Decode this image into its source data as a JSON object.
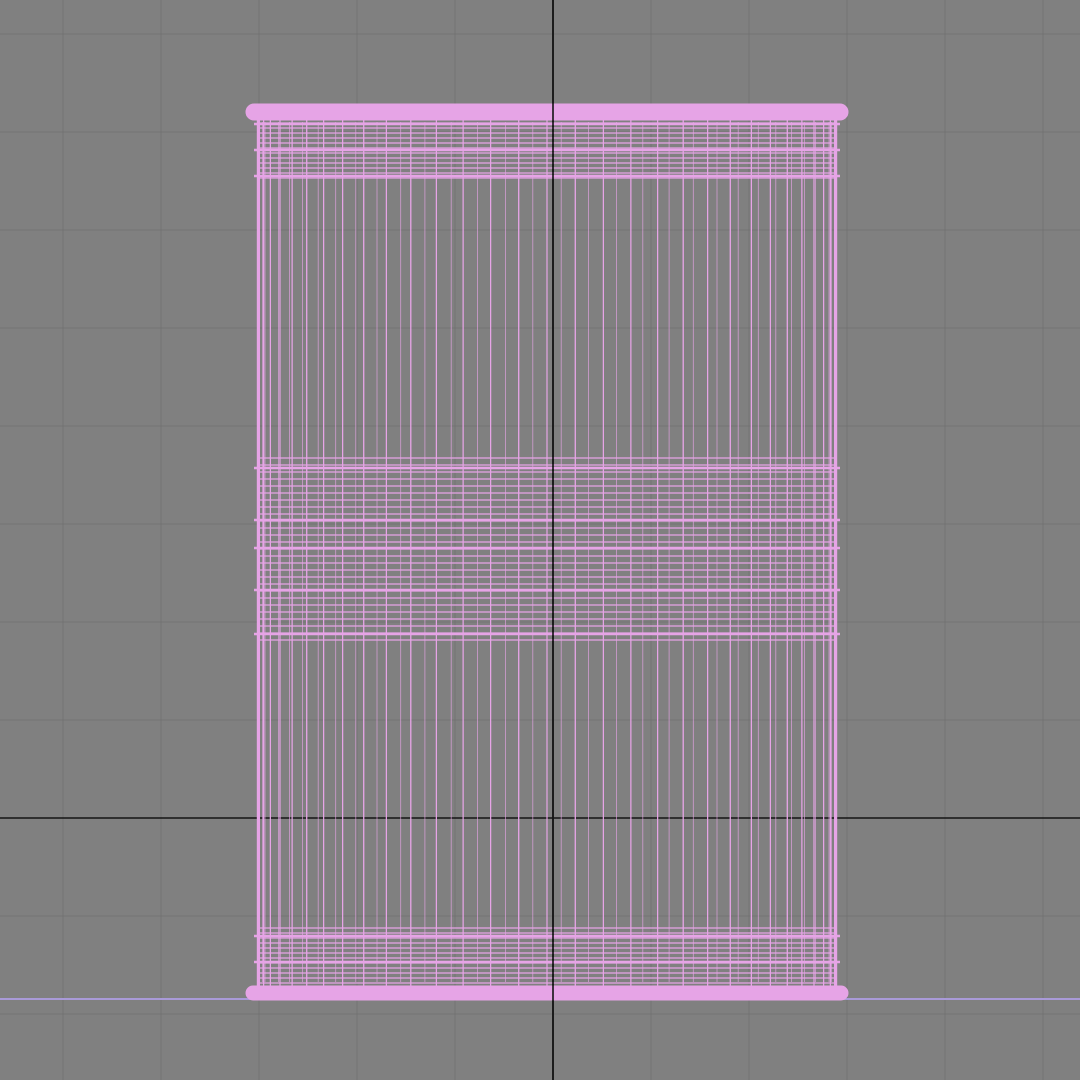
{
  "viewport": {
    "view": "front-orthographic",
    "background_color": "#808080",
    "grid_color": "#737373",
    "axis_color": "#141414",
    "ground_line_color": "#a99ad8",
    "wireframe_color": "#e6a4e6",
    "object": {
      "name": "",
      "shape": "cylinder-barrel",
      "display_mode": "wireframe",
      "selected": true
    }
  }
}
